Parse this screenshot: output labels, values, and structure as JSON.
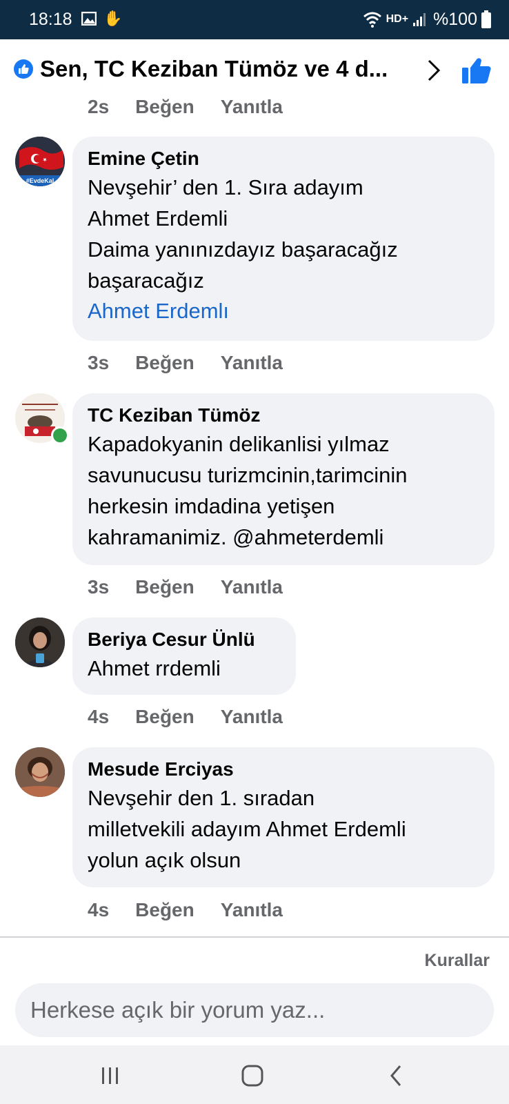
{
  "status_bar": {
    "time": "18:18",
    "network": "HD+",
    "battery": "%100"
  },
  "header": {
    "title": "Sen, TC Keziban Tümöz ve 4 d..."
  },
  "top_meta": {
    "time": "2s",
    "like": "Beğen",
    "reply": "Yanıtla"
  },
  "comments": [
    {
      "author": "Emine Çetin",
      "text": "Nevşehir’ den 1. Sıra adayım\nAhmet Erdemli\nDaima yanınızdayız başaracağız\nbaşaracağız",
      "link": "Ahmet Erdemlı",
      "time": "3s",
      "like": "Beğen",
      "reply": "Yanıtla",
      "avatar_caption": "#EvdeKal"
    },
    {
      "author": "TC Keziban Tümöz",
      "text": "Kapadokyanin delikanlisi yılmaz\nsavunucusu turizmcinin,tarimcinin\nherkesin imdadina yetişen\nkahramanimiz. @ahmeterdemli",
      "time": "3s",
      "like": "Beğen",
      "reply": "Yanıtla",
      "online": true
    },
    {
      "author": "Beriya Cesur Ünlü",
      "text": "Ahmet rrdemli",
      "time": "4s",
      "like": "Beğen",
      "reply": "Yanıtla"
    },
    {
      "author": "Mesude Erciyas",
      "text": "Nevşehir den 1. sıradan\nmilletvekili adayım Ahmet Erdemli\nyolun açık olsun",
      "time": "4s",
      "like": "Beğen",
      "reply": "Yanıtla"
    }
  ],
  "footer": {
    "rules_link": "Kurallar",
    "composer_placeholder": "Herkese açık bir yorum yaz..."
  },
  "colors": {
    "status_bar": "#0f2c45",
    "accent": "#1877f2",
    "bubble": "#f0f2f5",
    "meta_text": "#65676b",
    "link": "#1b66c9"
  },
  "icons": [
    "gallery-icon",
    "accessibility-icon",
    "wifi-icon",
    "signal-icon",
    "battery-icon",
    "like-icon",
    "chevron-right-icon",
    "recent-apps-icon",
    "home-icon",
    "back-icon"
  ]
}
